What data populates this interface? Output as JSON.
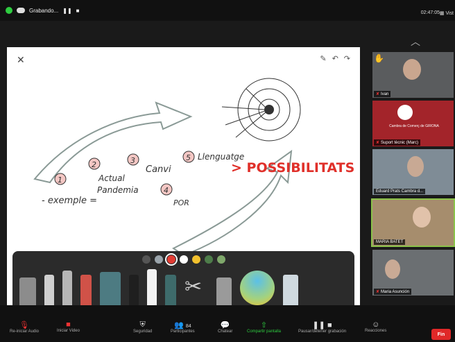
{
  "top": {
    "recording_label": "Grabando...",
    "time": "02:47:05",
    "view_label": "Vist"
  },
  "whiteboard": {
    "words": {
      "n1": "1",
      "exemple": "- exemple =",
      "n2": "2",
      "actual": "Actual",
      "pandemia": "Pandemia",
      "n3": "3",
      "canvi": "Canvi",
      "n4": "4",
      "por": "POR",
      "n5": "5",
      "llenguatge": "Llenguatge",
      "possibilitats": "> POSSIBILITATS ="
    }
  },
  "palette": {
    "colors": [
      "#555555",
      "#9aa4ab",
      "#e23c33",
      "#ffffff",
      "#f2c12e",
      "#4e7d4a",
      "#7fa86b"
    ],
    "selected_index": 2
  },
  "participants": [
    {
      "name": "Ivan",
      "raised_hand": true
    },
    {
      "name": "Suport tècnic (Marc)",
      "logo_text": "Cambra de Comerç de GIRONA"
    },
    {
      "name": "Eduard Prats Cambra d..."
    },
    {
      "name": "MARIA BATET",
      "active": true
    },
    {
      "name": "Maria Asunción"
    }
  ],
  "toolbar": {
    "audio": "Re-iniciar Audio",
    "video": "Iniciar Video",
    "security": "Seguridad",
    "participants": "Participantes",
    "participant_count": "84",
    "chat": "Chatear",
    "chat_badge": "2",
    "share": "Compartir pantalla",
    "recording": "Pausar/detener grabación",
    "reactions": "Reacciones",
    "end": "Fin"
  }
}
